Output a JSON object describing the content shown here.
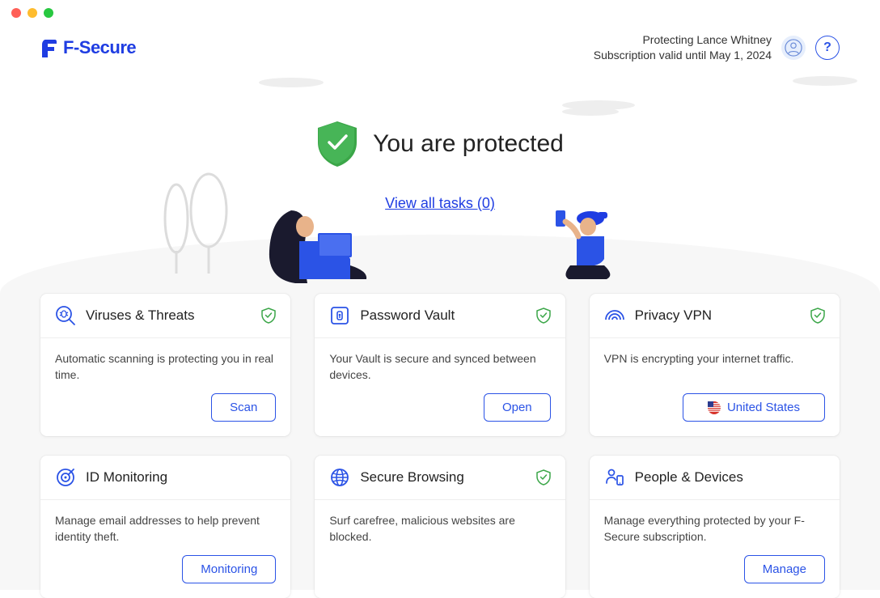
{
  "header": {
    "brand": "F-Secure",
    "protecting": "Protecting Lance Whitney",
    "subscription": "Subscription valid until May 1, 2024"
  },
  "hero": {
    "title": "You are protected",
    "tasks_link": "View all tasks (0)"
  },
  "cards": {
    "viruses": {
      "title": "Viruses & Threats",
      "desc": "Automatic scanning is protecting you in real time.",
      "action": "Scan"
    },
    "vault": {
      "title": "Password Vault",
      "desc": "Your Vault is secure and synced between devices.",
      "action": "Open"
    },
    "vpn": {
      "title": "Privacy VPN",
      "desc": "VPN is encrypting your internet traffic.",
      "action": "United States"
    },
    "idmon": {
      "title": "ID Monitoring",
      "desc": "Manage email addresses to help prevent identity theft.",
      "action": "Monitoring"
    },
    "browse": {
      "title": "Secure Browsing",
      "desc": "Surf carefree, malicious websites are blocked."
    },
    "people": {
      "title": "People & Devices",
      "desc": "Manage everything protected by your F-Secure subscription.",
      "action": "Manage"
    }
  }
}
